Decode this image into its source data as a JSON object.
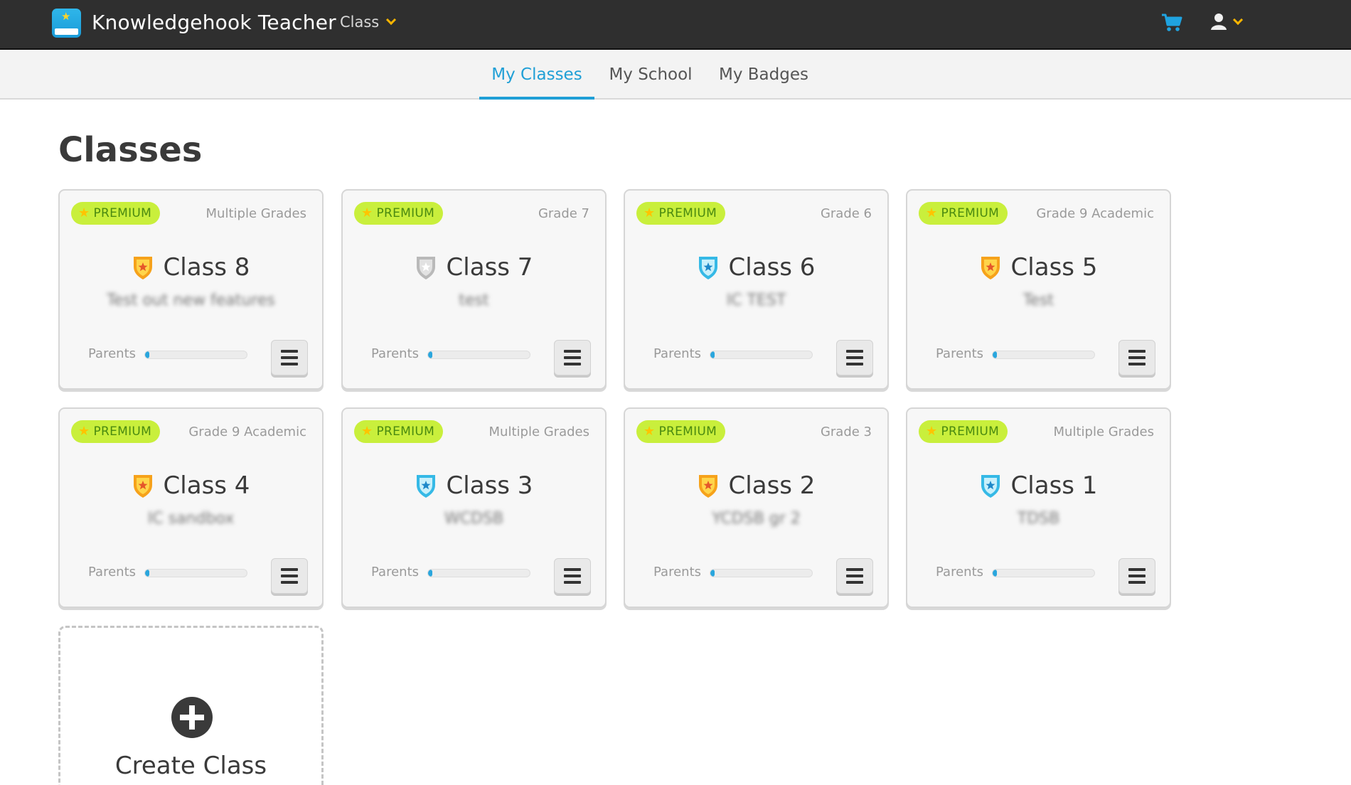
{
  "header": {
    "app_title": "Knowledgehook Teacher",
    "class_menu_label": "Class",
    "cart_icon": "cart-icon",
    "user_icon": "user-icon",
    "accent_color": "#1f9fd6"
  },
  "tabs": [
    {
      "label": "My Classes",
      "active": true
    },
    {
      "label": "My School",
      "active": false
    },
    {
      "label": "My Badges",
      "active": false
    }
  ],
  "page_title": "Classes",
  "classes": [
    {
      "badge": "PREMIUM",
      "grade": "Multiple Grades",
      "name": "Class 8",
      "subtitle": "Test out new features",
      "shield": "gold",
      "parents_label": "Parents",
      "parents_progress": 0.03
    },
    {
      "badge": "PREMIUM",
      "grade": "Grade 7",
      "name": "Class 7",
      "subtitle": "test",
      "shield": "silver",
      "parents_label": "Parents",
      "parents_progress": 0.03
    },
    {
      "badge": "PREMIUM",
      "grade": "Grade 6",
      "name": "Class 6",
      "subtitle": "IC TEST",
      "shield": "blue",
      "parents_label": "Parents",
      "parents_progress": 0.03
    },
    {
      "badge": "PREMIUM",
      "grade": "Grade 9 Academic",
      "name": "Class 5",
      "subtitle": "Test",
      "shield": "gold",
      "parents_label": "Parents",
      "parents_progress": 0.03
    },
    {
      "badge": "PREMIUM",
      "grade": "Grade 9 Academic",
      "name": "Class 4",
      "subtitle": "IC sandbox",
      "shield": "gold",
      "parents_label": "Parents",
      "parents_progress": 0.03
    },
    {
      "badge": "PREMIUM",
      "grade": "Multiple Grades",
      "name": "Class 3",
      "subtitle": "WCDSB",
      "shield": "blue",
      "parents_label": "Parents",
      "parents_progress": 0.03
    },
    {
      "badge": "PREMIUM",
      "grade": "Grade 3",
      "name": "Class 2",
      "subtitle": "YCDSB gr 2",
      "shield": "gold",
      "parents_label": "Parents",
      "parents_progress": 0.03
    },
    {
      "badge": "PREMIUM",
      "grade": "Multiple Grades",
      "name": "Class 1",
      "subtitle": "TDSB",
      "shield": "blue",
      "parents_label": "Parents",
      "parents_progress": 0.03
    }
  ],
  "create_class_label": "Create Class",
  "shield_colors": {
    "gold": {
      "outer": "#f6a21b",
      "inner": "#ffd54a",
      "star": "#e5572a"
    },
    "silver": {
      "outer": "#b9b9b9",
      "inner": "#e2e2e2",
      "star": "#ffffff"
    },
    "blue": {
      "outer": "#35b9e6",
      "inner": "#c8f0fb",
      "star": "#1e88c9"
    }
  }
}
